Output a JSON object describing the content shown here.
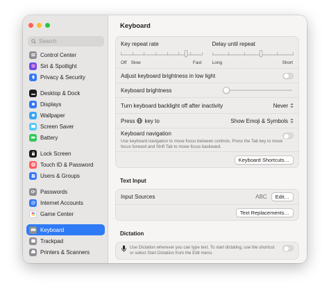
{
  "search": {
    "placeholder": "Search"
  },
  "sidebar": {
    "groups": [
      [
        {
          "label": "Control Center",
          "icon": "control-center-icon",
          "color": "#8e8e93"
        },
        {
          "label": "Siri & Spotlight",
          "icon": "siri-icon",
          "color": "#6b4de6"
        },
        {
          "label": "Privacy & Security",
          "icon": "hand-icon",
          "color": "#3478f6"
        }
      ],
      [
        {
          "label": "Desktop & Dock",
          "icon": "dock-icon",
          "color": "#1c1c1e"
        },
        {
          "label": "Displays",
          "icon": "sun-icon",
          "color": "#3478f6"
        },
        {
          "label": "Wallpaper",
          "icon": "flower-icon",
          "color": "#35a7f5"
        },
        {
          "label": "Screen Saver",
          "icon": "screen-saver-icon",
          "color": "#5ac8fa"
        },
        {
          "label": "Battery",
          "icon": "battery-icon",
          "color": "#34c759"
        }
      ],
      [
        {
          "label": "Lock Screen",
          "icon": "lock-icon",
          "color": "#1c1c1e"
        },
        {
          "label": "Touch ID & Password",
          "icon": "fingerprint-icon",
          "color": "#ff5a5f"
        },
        {
          "label": "Users & Groups",
          "icon": "users-icon",
          "color": "#3478f6"
        }
      ],
      [
        {
          "label": "Passwords",
          "icon": "key-icon",
          "color": "#8e8e93"
        },
        {
          "label": "Internet Accounts",
          "icon": "at-icon",
          "color": "#3478f6"
        },
        {
          "label": "Game Center",
          "icon": "game-center-icon",
          "color": "#ffffff"
        }
      ],
      [
        {
          "label": "Keyboard",
          "icon": "keyboard-icon",
          "color": "#8e8e93",
          "selected": true
        },
        {
          "label": "Trackpad",
          "icon": "trackpad-icon",
          "color": "#8e8e93"
        },
        {
          "label": "Printers & Scanners",
          "icon": "printer-icon",
          "color": "#8e8e93"
        }
      ]
    ]
  },
  "main": {
    "title": "Keyboard",
    "key_repeat": {
      "label": "Key repeat rate",
      "left_labels": [
        "Off",
        "Slow"
      ],
      "right_label": "Fast",
      "value_fraction": 0.8
    },
    "delay_repeat": {
      "label": "Delay until repeat",
      "left_label": "Long",
      "right_label": "Short",
      "value_fraction": 0.6
    },
    "adjust_brightness": {
      "label": "Adjust keyboard brightness in low light",
      "enabled": false
    },
    "brightness": {
      "label": "Keyboard brightness",
      "value_fraction": 0.0
    },
    "backlight_off": {
      "label": "Turn keyboard backlight off after inactivity",
      "value": "Never"
    },
    "press_key": {
      "label_before": "Press",
      "label_after": "key to",
      "value": "Show Emoji & Symbols"
    },
    "keyboard_navigation": {
      "label": "Keyboard navigation",
      "description": "Use keyboard navigation to move focus between controls. Press the Tab key to move focus forward and Shift Tab to move focus backward.",
      "enabled": false
    },
    "shortcuts_button": "Keyboard Shortcuts…",
    "text_input": {
      "title": "Text Input",
      "input_sources_label": "Input Sources",
      "input_sources_value": "ABC",
      "edit_button": "Edit…",
      "replacements_button": "Text Replacements…"
    },
    "dictation": {
      "title": "Dictation",
      "description": "Use Dictation wherever you can type text. To start dictating, use the shortcut or select Start Dictation from the Edit menu."
    }
  },
  "colors": {
    "accent": "#2f7bf6"
  }
}
